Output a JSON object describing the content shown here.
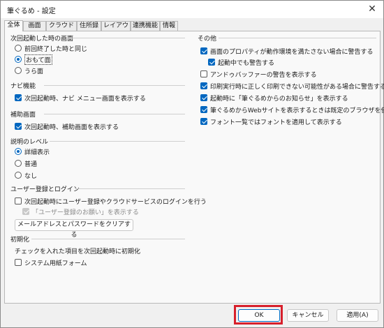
{
  "window": {
    "title": "筆ぐるめ - 設定",
    "close_glyph": "✕"
  },
  "tabs": [
    {
      "label": "全体",
      "active": true
    },
    {
      "label": "画面"
    },
    {
      "label": "クラウド"
    },
    {
      "label": "住所録"
    },
    {
      "label": "レイアウト"
    },
    {
      "label": "連携機能"
    },
    {
      "label": "情報"
    }
  ],
  "left": {
    "startup": {
      "heading": "次回起動した時の画面",
      "options": [
        "前回終了した時と同じ",
        "おもて面",
        "うら面"
      ],
      "selected": "おもて面"
    },
    "navi": {
      "heading": "ナビ機能",
      "items": [
        {
          "label": "次回起動時、ナビ メニュー画面を表示する",
          "checked": true
        }
      ]
    },
    "assist": {
      "heading": "補助画面",
      "items": [
        {
          "label": "次回起動時、補助画面を表示する",
          "checked": true
        }
      ]
    },
    "level": {
      "heading": "説明のレベル",
      "options": [
        "詳細表示",
        "普通",
        "なし"
      ],
      "selected": "詳細表示"
    },
    "user": {
      "heading": "ユーザー登録とログイン",
      "items": [
        {
          "label": "次回起動時にユーザー登録やクラウドサービスのログインを行う",
          "checked": false
        },
        {
          "label": "「ユーザー登録のお願い」を表示する",
          "checked": true,
          "disabled": true
        }
      ],
      "clear_button": "メールアドレスとパスワードをクリアする"
    },
    "init": {
      "heading": "初期化",
      "description": "チェックを入れた項目を次回起動時に初期化",
      "items": [
        {
          "label": "システム用紙フォーム",
          "checked": false
        }
      ]
    }
  },
  "right": {
    "other": {
      "heading": "その他",
      "items": [
        {
          "label": "画面のプロパティが動作環境を満たさない場合に警告する",
          "checked": true
        },
        {
          "label": "起動中でも警告する",
          "checked": true
        },
        {
          "label": "アンドゥバッファーの警告を表示する",
          "checked": false
        },
        {
          "label": "印刷実行時に正しく印刷できない可能性がある場合に警告する",
          "checked": true
        },
        {
          "label": "起動時に「筆ぐるめからのお知らせ」を表示する",
          "checked": true
        },
        {
          "label": "筆ぐるめからWebサイトを表示するときは既定のブラウザを使う",
          "checked": true
        },
        {
          "label": "フォント一覧ではフォントを適用して表示する",
          "checked": true
        }
      ]
    }
  },
  "footer": {
    "ok": "OK",
    "cancel": "キャンセル",
    "apply": "適用(A)"
  }
}
